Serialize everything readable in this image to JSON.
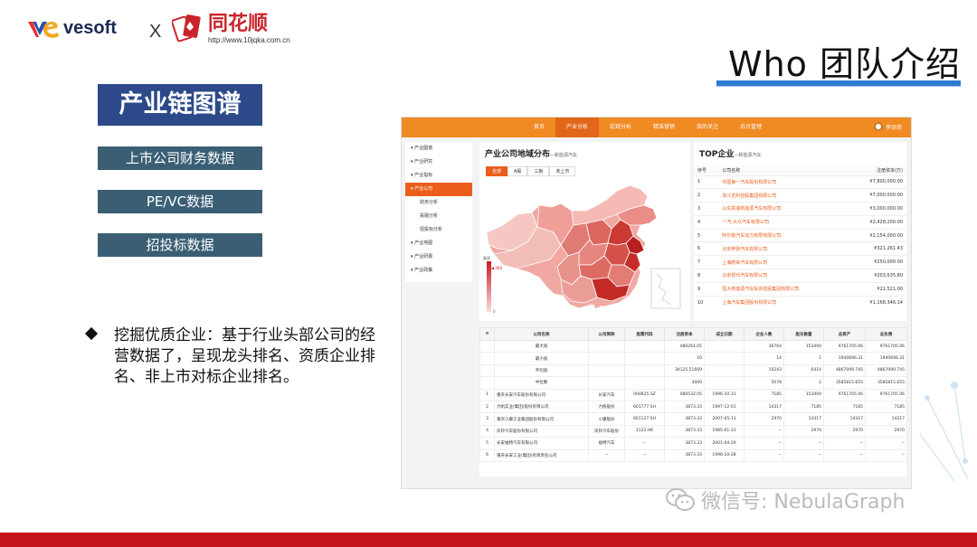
{
  "logos": {
    "vesoft": "vesoft",
    "separator": "X",
    "ths_name": "同花顺",
    "ths_url": "http://www.10jqka.com.cn"
  },
  "title": "Who 团队介绍",
  "left_nav": {
    "chain": "产业链图谱",
    "items": [
      "上市公司财务数据",
      "PE/VC数据",
      "招投标数据"
    ]
  },
  "bullet": "挖掘优质企业：基于行业头部公司的经营数据了，呈现龙头排名、资质企业排名、非上市对标企业排名。",
  "watermark": "微信号: NebulaGraph",
  "app": {
    "nav": [
      "首页",
      "产业分析",
      "宏观分析",
      "精准营销",
      "我的关注",
      "后台管理"
    ],
    "nav_active_index": 1,
    "user": "李琼奇",
    "sidebar": [
      {
        "label": "▾ 产业图谱",
        "sub": false,
        "active": false
      },
      {
        "label": "▾ 产业研究",
        "sub": false,
        "active": false
      },
      {
        "label": "▾ 产业指标",
        "sub": false,
        "active": false
      },
      {
        "label": "▾ 产业公司",
        "sub": false,
        "active": true
      },
      {
        "label": "财务分析",
        "sub": true,
        "active": false
      },
      {
        "label": "投融分析",
        "sub": true,
        "active": false
      },
      {
        "label": "招投标分析",
        "sub": true,
        "active": false
      },
      {
        "label": "▾ 产业地图",
        "sub": false,
        "active": false
      },
      {
        "label": "▾ 产业研报",
        "sub": false,
        "active": false
      },
      {
        "label": "▾ 产业政策",
        "sub": false,
        "active": false
      }
    ],
    "map_card": {
      "title": "产业公司地域分布",
      "subtitle": "—新能源汽车",
      "tabs": [
        "全部",
        "A股",
        "三板",
        "未上市"
      ],
      "active_tab": 0,
      "legend_high": "最高",
      "legend_low": "0",
      "legend_mark": "◀ 400"
    },
    "top_card": {
      "title": "TOP企业",
      "subtitle": "—新能源汽车",
      "headers": [
        "序号",
        "公司名称",
        "注册资本(万)"
      ],
      "rows": [
        [
          "1",
          "中国第一汽车股份有限公司",
          "¥7,800,000.00"
        ],
        [
          "2",
          "浙江吉利控股集团有限公司",
          "¥7,000,000.00"
        ],
        [
          "3",
          "山东高速新能源汽车有限公司",
          "¥3,000,000.00"
        ],
        [
          "4",
          "一汽-大众汽车有限公司",
          "¥2,428,200.00"
        ],
        [
          "5",
          "阿尔斯汽车动力有限有限公司",
          "¥2,154,000.00"
        ],
        [
          "6",
          "北京奔驰汽车有限公司",
          "¥321,261.43"
        ],
        [
          "7",
          "上海蔚来汽车有限公司",
          "¥250,000.00"
        ],
        [
          "8",
          "北京现代汽车有限公司",
          "¥203,635.80"
        ],
        [
          "9",
          "恒大新能源汽车投资控股集团有限公司",
          "¥21,521.00"
        ],
        [
          "10",
          "上海汽车集团股份有限公司",
          "¥1,168,346.14"
        ]
      ]
    },
    "data_table": {
      "headers": [
        "",
        "公司名称",
        "公司简称",
        "股票代码",
        "注册资本",
        "成立日期",
        "企业人数",
        "股东数量",
        "总资产",
        "总负债"
      ],
      "summary": [
        [
          "",
          "最大值",
          "",
          "",
          "480264.05",
          "",
          "36764",
          "153400",
          "9761705.06",
          "9761705.06"
        ],
        [
          "",
          "最小值",
          "",
          "",
          "10",
          "",
          "14",
          "1",
          "1940696.31",
          "1940696.31"
        ],
        [
          "",
          "平均值",
          "",
          "",
          "34125.51669",
          "",
          "10243",
          "6414",
          "4867099.745",
          "4867099.745"
        ],
        [
          "",
          "中位数",
          "",
          "",
          "3000",
          "",
          "5078",
          "2",
          "3585815.655",
          "3585815.655"
        ]
      ],
      "rows": [
        [
          "1",
          "重庆长安汽车股份有限公司",
          "长安汽车",
          "000625.SZ",
          "480532.05",
          "1996-10-31",
          "7185",
          "153400",
          "9761705.06",
          "9761705.06"
        ],
        [
          "2",
          "力帆实业(集团)股份有限公司",
          "力帆股份",
          "601777.SH",
          "3873.33",
          "1997-12-01",
          "14317",
          "7185",
          "7185",
          "7185"
        ],
        [
          "3",
          "重庆小康工业集团股份有限公司",
          "小康股份",
          "601127.SH",
          "3873.33",
          "2007-05-11",
          "2970",
          "14317",
          "14317",
          "14317"
        ],
        [
          "4",
          "庆铃汽车股份有限公司",
          "庆铃汽车股份",
          "1122.HK",
          "3873.33",
          "1985-01-31",
          "--",
          "2970",
          "2970",
          "2970"
        ],
        [
          "5",
          "长安福特汽车有限公司",
          "福特汽车",
          "--",
          "3873.33",
          "2001-04-29",
          "--",
          "--",
          "--",
          "--"
        ],
        [
          "6",
          "重庆长安工业(集团)有限责任公司",
          "--",
          "--",
          "3873.33",
          "1996-10-28",
          "--",
          "--",
          "--",
          "--"
        ]
      ]
    }
  },
  "colors": {
    "accent_orange": "#f08a22",
    "nav_blue": "#2c4a8a",
    "bar_red": "#c4141b"
  }
}
